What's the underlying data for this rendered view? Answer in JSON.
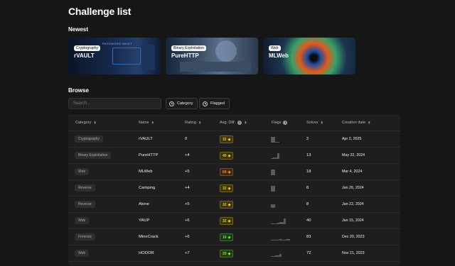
{
  "page": {
    "title": "Challenge list",
    "newest_heading": "Newest",
    "browse_heading": "Browse"
  },
  "newest": [
    {
      "category": "Cryptography",
      "name": "rVAULT"
    },
    {
      "category": "Binary Exploitation",
      "name": "PureHTTP"
    },
    {
      "category": "Web",
      "name": "MLWeb"
    }
  ],
  "card_art_text": "PASSWORD VAULT",
  "search": {
    "placeholder": "Search..."
  },
  "filters": {
    "category": "Category",
    "flagged": "Flagged"
  },
  "table": {
    "headers": {
      "category": "Category",
      "name": "Name",
      "rating": "Rating",
      "avg_diff": "Avg. Diff.",
      "flags": "Flags",
      "solves": "Solves",
      "creation_date": "Creation date"
    },
    "rows": [
      {
        "category": "Cryptography",
        "name": "rVAULT",
        "rating": "0",
        "diff": "32",
        "diff_color": "#f0c419",
        "diff_bg": "#3a3512",
        "flags": [
          1,
          0
        ],
        "solves": "2",
        "date": "Apr 2, 2025"
      },
      {
        "category": "Binary Exploitation",
        "name": "PureHTTP",
        "rating": "+4",
        "diff": "40",
        "diff_color": "#e8c020",
        "diff_bg": "#3b3412",
        "flags": [
          0.1,
          0.2,
          0.2,
          1
        ],
        "solves": "13",
        "date": "May 22, 2024"
      },
      {
        "category": "Web",
        "name": "MLWeb",
        "rating": "+5",
        "diff": "64",
        "diff_color": "#f08a2a",
        "diff_bg": "#3e2a14",
        "flags": [
          1
        ],
        "solves": "18",
        "date": "Mar 4, 2024"
      },
      {
        "category": "Reverse",
        "name": "Camping",
        "rating": "+4",
        "diff": "32",
        "diff_color": "#f0c419",
        "diff_bg": "#3a3512",
        "flags": [
          1
        ],
        "solves": "8",
        "date": "Jan 26, 2024"
      },
      {
        "category": "Reverse",
        "name": "Alone",
        "rating": "+5",
        "diff": "32",
        "diff_color": "#f0c419",
        "diff_bg": "#3a3512",
        "flags": [
          0.6
        ],
        "solves": "8",
        "date": "Jan 22, 2024"
      },
      {
        "category": "Web",
        "name": "YAUP",
        "rating": "+6",
        "diff": "32",
        "diff_color": "#f0c419",
        "diff_bg": "#3a3512",
        "flags": [
          0.1,
          0.1,
          0.1,
          0.2,
          0.4,
          0.4,
          1
        ],
        "solves": "40",
        "date": "Jan 15, 2024"
      },
      {
        "category": "Forensic",
        "name": "MineCrack",
        "rating": "+6",
        "diff": "10",
        "diff_color": "#6ee04a",
        "diff_bg": "#1d3a16",
        "flags": [
          0.1,
          0.1,
          0.15,
          0.15,
          0.2,
          0.15,
          0.1,
          0.2,
          0.2
        ],
        "solves": "83",
        "date": "Dec 20, 2023"
      },
      {
        "category": "Web",
        "name": "HODOR",
        "rating": "+7",
        "diff": "20",
        "diff_color": "#8ee04a",
        "diff_bg": "#223a16",
        "flags": [
          0.1,
          0.15,
          0.2,
          0.3,
          0.5
        ],
        "solves": "72",
        "date": "Nov 21, 2023"
      }
    ]
  },
  "icons": {
    "sort": "sort-arrows-icon",
    "info": "info-icon",
    "add": "plus-circle-icon",
    "difficulty": "diamond-icon"
  }
}
